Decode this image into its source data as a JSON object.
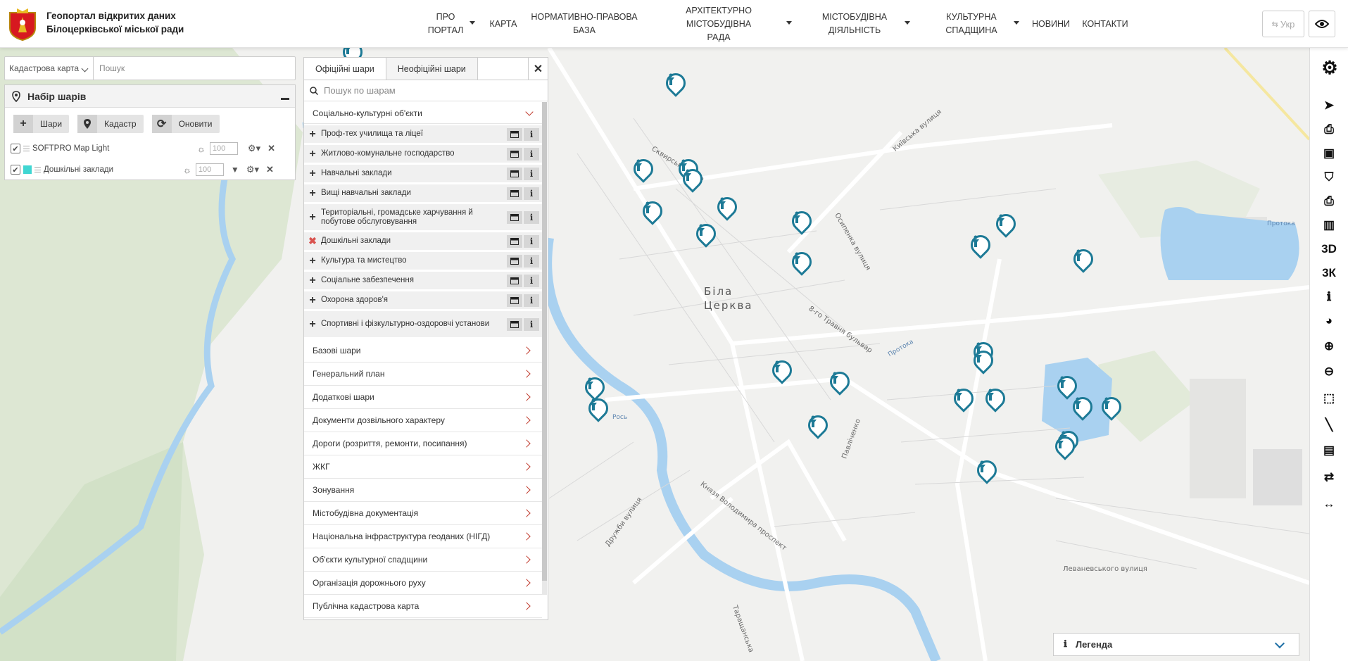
{
  "header": {
    "title_line1": "Геопортал відкритих даних",
    "title_line2": "Білоцерківської міської ради",
    "nav": [
      {
        "line1": "ПРО",
        "line2": "ПОРТАЛ"
      },
      {
        "line1": "КАРТА",
        "line2": ""
      },
      {
        "line1": "НОРМАТИВНО-ПРАВОВА",
        "line2": "БАЗА"
      },
      {
        "line1": "АРХІТЕКТУРНО МІСТОБУДІВНА",
        "line2": "РАДА"
      },
      {
        "line1": "МІСТОБУДІВНА",
        "line2": "ДІЯЛЬНІСТЬ"
      },
      {
        "line1": "КУЛЬТУРНА",
        "line2": "СПАДЩИНА"
      },
      {
        "line1": "НОВИНИ",
        "line2": ""
      },
      {
        "line1": "КОНТАКТИ",
        "line2": ""
      }
    ],
    "lang": "Укр"
  },
  "search": {
    "select_value": "Кадастрова карта",
    "placeholder": "Пошук"
  },
  "layers_panel": {
    "title": "Набір шарів",
    "buttons": {
      "layers": "Шари",
      "cadastre": "Кадастр",
      "refresh": "Оновити"
    },
    "rows": [
      {
        "name": "SOFTPRO Map Light",
        "opacity": "100"
      },
      {
        "name": "Дошкільні заклади",
        "opacity": "100"
      }
    ]
  },
  "catalog": {
    "tab_official": "Офіційні шари",
    "tab_unofficial": "Неофіційні шари",
    "search_placeholder": "Пошук по шарам",
    "open_group": "Соціально-культурні об'єкти",
    "sub_layers": [
      "Проф-тех училища та ліцеї",
      "Житлово-комунальне господарство",
      "Навчальні заклади",
      "Вищі навчальні заклади",
      "Територіальні, громадське харчування й побутове обслуговування",
      "Дошкільні заклади",
      "Культура та мистецтво",
      "Соціальне забезпечення",
      "Охорона здоров'я",
      "Спортивні і фізкультурно-оздоровчі установи"
    ],
    "groups": [
      "Базові шари",
      "Генеральний план",
      "Додаткові шари",
      "Документи дозвільного характеру",
      "Дороги (розриття, ремонти, посипання)",
      "ЖКГ",
      "Зонування",
      "Містобудівна документація",
      "Національна інфраструктура геоданих (НІГД)",
      "Об'єкти культурної спадщини",
      "Організація дорожнього руху",
      "Публічна кадастрова карта"
    ]
  },
  "toolbar": {
    "btn_3d": "3D",
    "btn_3k": "3К"
  },
  "legend": {
    "title": "Легенда"
  },
  "map": {
    "city_line1": "Біла",
    "city_line2": "Церква",
    "labels": [
      "Сквирське шосе",
      "Київська вулиця",
      "Осипенка вулиця",
      "8-го Травня бульвар",
      "Протока",
      "Рось",
      "Павліченко",
      "Князя Володимира проспект",
      "Дружби вулиця",
      "Левaневського вулиця",
      "Таращанська",
      "Протока"
    ],
    "accent": "#1d7a96"
  }
}
